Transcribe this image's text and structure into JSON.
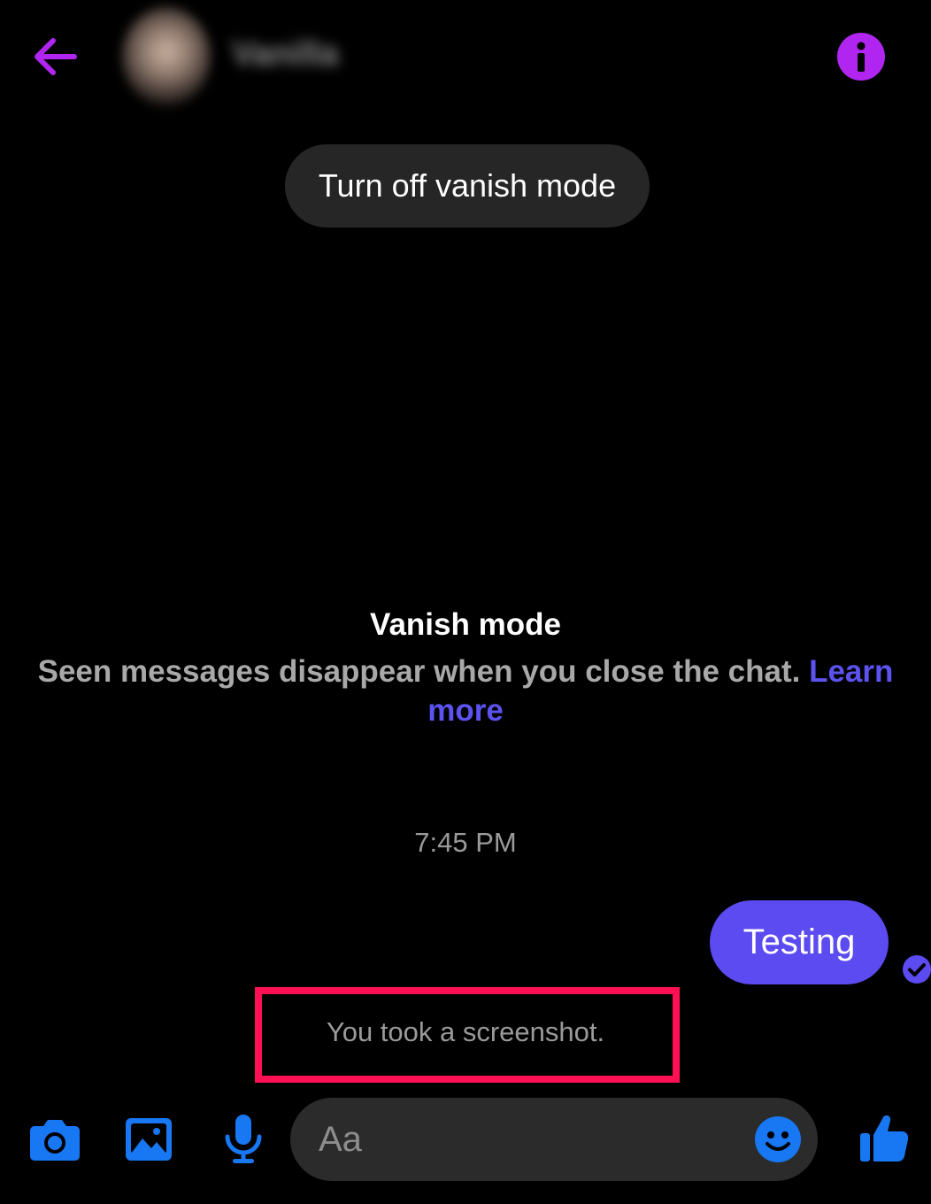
{
  "header": {
    "contact_name": "Vanilla",
    "back_icon": "arrow-left-icon",
    "info_icon": "info-icon",
    "accent_color": "#b026f0"
  },
  "vanish_toggle": {
    "label": "Turn off vanish mode"
  },
  "vanish_info": {
    "title": "Vanish mode",
    "description": "Seen messages disappear when you close the chat.",
    "link_label": "Learn more",
    "link_color": "#5b52f0"
  },
  "thread": {
    "timestamp": "7:45 PM",
    "messages": [
      {
        "text": "Testing",
        "sender": "me",
        "status_icon": "check-circle-icon",
        "bubble_color": "#5b4bf0"
      }
    ],
    "system_notice": "You took a screenshot.",
    "highlight_color": "#ff1053"
  },
  "composer": {
    "placeholder": "Aa",
    "icons": [
      "camera-icon",
      "image-icon",
      "microphone-icon",
      "emoji-icon",
      "thumbs-up-icon"
    ],
    "icon_color": "#1877f2"
  }
}
